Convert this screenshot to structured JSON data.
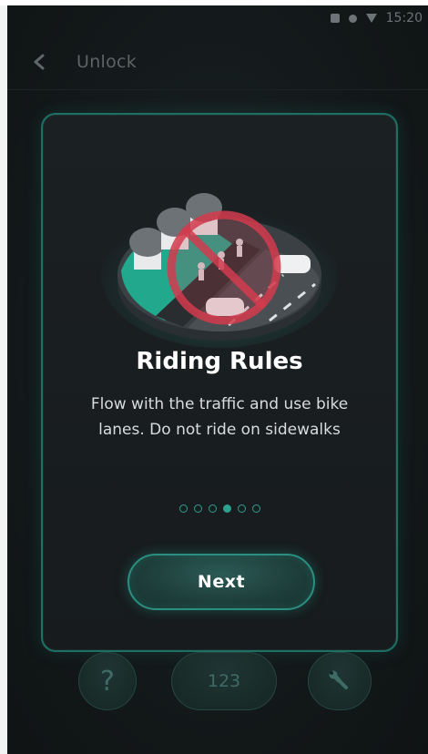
{
  "status_bar": {
    "time": "15:20"
  },
  "app_bar": {
    "title": "Unlock"
  },
  "card": {
    "title": "Riding Rules",
    "body": "Flow with the traffic and use bike lanes. Do not ride on sidewalks",
    "pager": {
      "total": 6,
      "active_index": 3
    },
    "next_label": "Next"
  },
  "bottom_buttons": {
    "help_label": "?",
    "code_label": "123"
  },
  "colors": {
    "accent": "#2da08e",
    "card_border": "#1f6f63",
    "background": "#141a1c"
  },
  "icons": [
    "back-arrow-icon",
    "no-riding-on-sidewalk-illustration",
    "wrench-icon",
    "signal-icon",
    "battery-icon"
  ]
}
